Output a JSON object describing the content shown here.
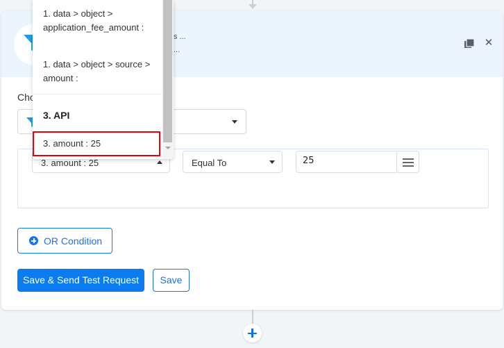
{
  "step": {
    "header_line1": "s ...",
    "header_line2": "...",
    "choose_label": "Cho",
    "app_icon": "funnel-icon",
    "actions": [
      "copy-icon",
      "close-icon"
    ]
  },
  "condition": {
    "field_value": "3. amount : 25",
    "operator_value": "Equal To",
    "compare_value": "25",
    "menu_icon": "hamburger-icon"
  },
  "dropdown": {
    "items": [
      {
        "label": "1. data > object > application_fee_amount :"
      },
      {
        "label": "1. data > object > source > amount :"
      }
    ],
    "group_label": "3. API",
    "selected_item": "3. amount : 25"
  },
  "buttons": {
    "or_condition": "OR Condition",
    "save_send": "Save & Send Test Request",
    "save": "Save"
  },
  "colors": {
    "primary": "#0a7cf0",
    "highlight": "#e8000b",
    "header_bg": "#ecf5fe"
  }
}
